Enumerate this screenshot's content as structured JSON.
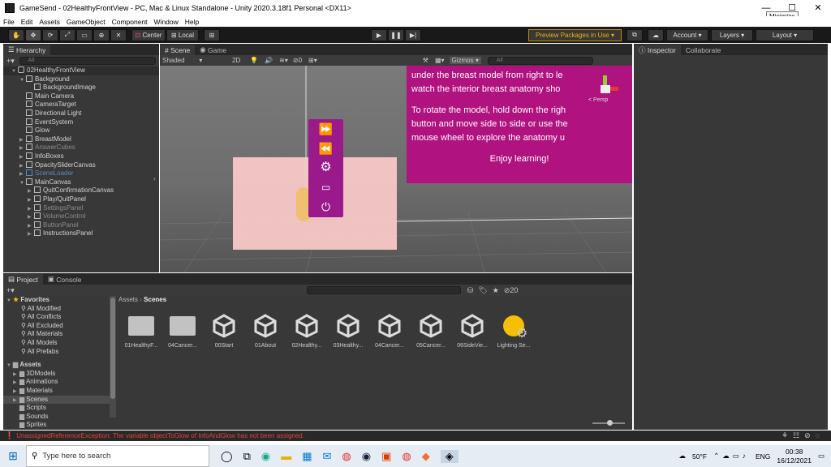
{
  "window": {
    "title": "GameSend - 02HealthyFrontView - PC, Mac & Linux Standalone - Unity 2020.3.18f1 Personal <DX11>",
    "tooltip": "Minimize",
    "controls": [
      "—",
      "☐",
      "✕"
    ]
  },
  "menu": [
    "File",
    "Edit",
    "Assets",
    "GameObject",
    "Component",
    "Window",
    "Help"
  ],
  "toolbar": {
    "center_label": "Center",
    "local_label": "Local",
    "preview_packages": "Preview Packages in Use ▾",
    "account": "Account",
    "layers": "Layers",
    "layout": "Layout"
  },
  "hierarchy": {
    "tab": "Hierarchy",
    "search_placeholder": "All",
    "root": "02HealthyFrontView",
    "items": [
      {
        "label": "Background",
        "indent": 1,
        "tri": "▼",
        "dim": false
      },
      {
        "label": "BackgroundImage",
        "indent": 2,
        "tri": "",
        "dim": false
      },
      {
        "label": "Main Camera",
        "indent": 1,
        "tri": "",
        "dim": false
      },
      {
        "label": "CameraTarget",
        "indent": 1,
        "tri": "",
        "dim": false
      },
      {
        "label": "Directional Light",
        "indent": 1,
        "tri": "",
        "dim": false
      },
      {
        "label": "EventSystem",
        "indent": 1,
        "tri": "",
        "dim": false
      },
      {
        "label": "Glow",
        "indent": 1,
        "tri": "",
        "dim": false
      },
      {
        "label": "BreastModel",
        "indent": 1,
        "tri": "▶",
        "dim": false
      },
      {
        "label": "AnswerCubes",
        "indent": 1,
        "tri": "▶",
        "dim": true
      },
      {
        "label": "InfoBoxes",
        "indent": 1,
        "tri": "▶",
        "dim": false
      },
      {
        "label": "OpacitySliderCanvas",
        "indent": 1,
        "tri": "▶",
        "dim": false
      },
      {
        "label": "SceneLoader",
        "indent": 1,
        "tri": "▶",
        "dim": false,
        "sel": true
      },
      {
        "label": "MainCanvas",
        "indent": 1,
        "tri": "▼",
        "dim": false
      },
      {
        "label": "QuitConfirmationCanvas",
        "indent": 2,
        "tri": "▶",
        "dim": false
      },
      {
        "label": "Play/QuitPanel",
        "indent": 2,
        "tri": "▶",
        "dim": false
      },
      {
        "label": "SettingsPanel",
        "indent": 2,
        "tri": "▶",
        "dim": true
      },
      {
        "label": "VolumeControl",
        "indent": 2,
        "tri": "▶",
        "dim": true
      },
      {
        "label": "ButtonPanel",
        "indent": 2,
        "tri": "▶",
        "dim": true
      },
      {
        "label": "InstructionsPanel",
        "indent": 2,
        "tri": "▶",
        "dim": false
      }
    ]
  },
  "scene": {
    "tabs": [
      "Scene",
      "Game"
    ],
    "shading": "Shaded",
    "mode2d": "2D",
    "hidden_count": "0",
    "gizmos": "Gizmos ▾",
    "search_placeholder": "All",
    "persp_label": "< Persp",
    "panel_text": [
      "under the breast model from right to le",
      "watch the interior breast anatomy sho",
      "To rotate the model, hold down the righ",
      "button and move side to side or use the",
      "mouse wheel to explore the anatomy u",
      "Enjoy learning!"
    ]
  },
  "inspector": {
    "tabs": [
      "Inspector",
      "Collaborate"
    ]
  },
  "project": {
    "tabs": [
      "Project",
      "Console"
    ],
    "favorites_title": "Favorites",
    "favorites": [
      "All Modified",
      "All Conflicts",
      "All Excluded",
      "All Materials",
      "All Models",
      "All Prefabs"
    ],
    "assets_title": "Assets",
    "assets_tree": [
      "3DModels",
      "Animations",
      "Materials",
      "Scenes",
      "Scripts",
      "Sounds",
      "Sprites"
    ],
    "breadcrumb_root": "Assets",
    "breadcrumb_current": "Scenes",
    "hidden_count": "20",
    "files": [
      {
        "label": "01HealthyF...",
        "kind": "folder"
      },
      {
        "label": "04Cancer...",
        "kind": "folder"
      },
      {
        "label": "00Start",
        "kind": "scene"
      },
      {
        "label": "01About",
        "kind": "scene"
      },
      {
        "label": "02Healthy...",
        "kind": "scene"
      },
      {
        "label": "03Healthy...",
        "kind": "scene"
      },
      {
        "label": "04Cancer...",
        "kind": "scene"
      },
      {
        "label": "05Cancer...",
        "kind": "scene"
      },
      {
        "label": "06SideVie...",
        "kind": "scene"
      },
      {
        "label": "Lighting Se...",
        "kind": "lighting"
      }
    ]
  },
  "console_error": "UnassignedReferenceException: The variable objectToGlow of InfoAndGlow has not been assigned.",
  "taskbar": {
    "search_placeholder": "Type here to search",
    "weather": "50°F",
    "lang": "ENG",
    "time": "00:38",
    "date": "16/12/2021"
  },
  "colors": {
    "magenta_panel": "#b0127f",
    "menu_strip": "#9a1a8c",
    "pink_plane": "#f8c8c8",
    "error_red": "#e0443a",
    "selected_blue": "#2c5d87"
  }
}
